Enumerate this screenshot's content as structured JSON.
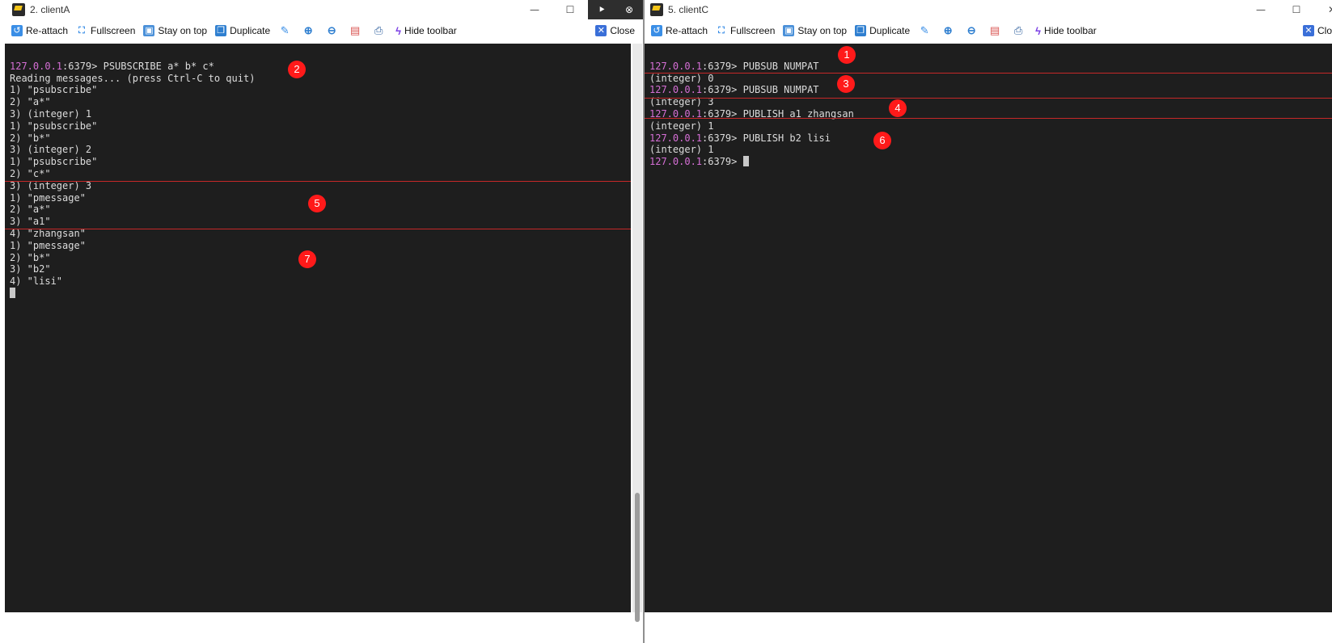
{
  "windows": {
    "clientA": {
      "title": "2. clientA",
      "controls": {
        "minimize": "—",
        "maximize": "☐",
        "extra1": "⯈",
        "extra2": "⊗"
      },
      "toolbar": {
        "reattach": "Re-attach",
        "fullscreen": "Fullscreen",
        "stay_on_top": "Stay on top",
        "duplicate": "Duplicate",
        "hide_toolbar": "Hide toolbar",
        "close": "Close"
      },
      "terminal": {
        "line1_prompt": "127.0.0.1",
        "line1_cmd": ":6379> PSUBSCRIBE a* b* c*",
        "lines": [
          "Reading messages... (press Ctrl-C to quit)",
          "1) \"psubscribe\"",
          "2) \"a*\"",
          "3) (integer) 1",
          "1) \"psubscribe\"",
          "2) \"b*\"",
          "3) (integer) 2",
          "1) \"psubscribe\"",
          "2) \"c*\"",
          "3) (integer) 3",
          "1) \"pmessage\"",
          "2) \"a*\"",
          "3) \"a1\"",
          "4) \"zhangsan\"",
          "1) \"pmessage\"",
          "2) \"b*\"",
          "3) \"b2\"",
          "4) \"lisi\""
        ]
      },
      "badges": [
        "2",
        "5",
        "7"
      ]
    },
    "clientC": {
      "title": "5. clientC",
      "controls": {
        "minimize": "—",
        "maximize": "☐",
        "close": "✕"
      },
      "toolbar": {
        "reattach": "Re-attach",
        "fullscreen": "Fullscreen",
        "stay_on_top": "Stay on top",
        "duplicate": "Duplicate",
        "hide_toolbar": "Hide toolbar",
        "close": "Clos"
      },
      "terminal": {
        "prompt_host": "127.0.0.1",
        "entries": [
          {
            "cmd": ":6379> PUBSUB NUMPAT",
            "result": "(integer) 0"
          },
          {
            "cmd": ":6379> PUBSUB NUMPAT",
            "result": "(integer) 3"
          },
          {
            "cmd": ":6379> PUBLISH a1 zhangsan",
            "result": "(integer) 1"
          },
          {
            "cmd": ":6379> PUBLISH b2 lisi",
            "result": "(integer) 1"
          }
        ],
        "final_prompt": ":6379> "
      },
      "badges": [
        "1",
        "3",
        "4",
        "6"
      ]
    }
  }
}
